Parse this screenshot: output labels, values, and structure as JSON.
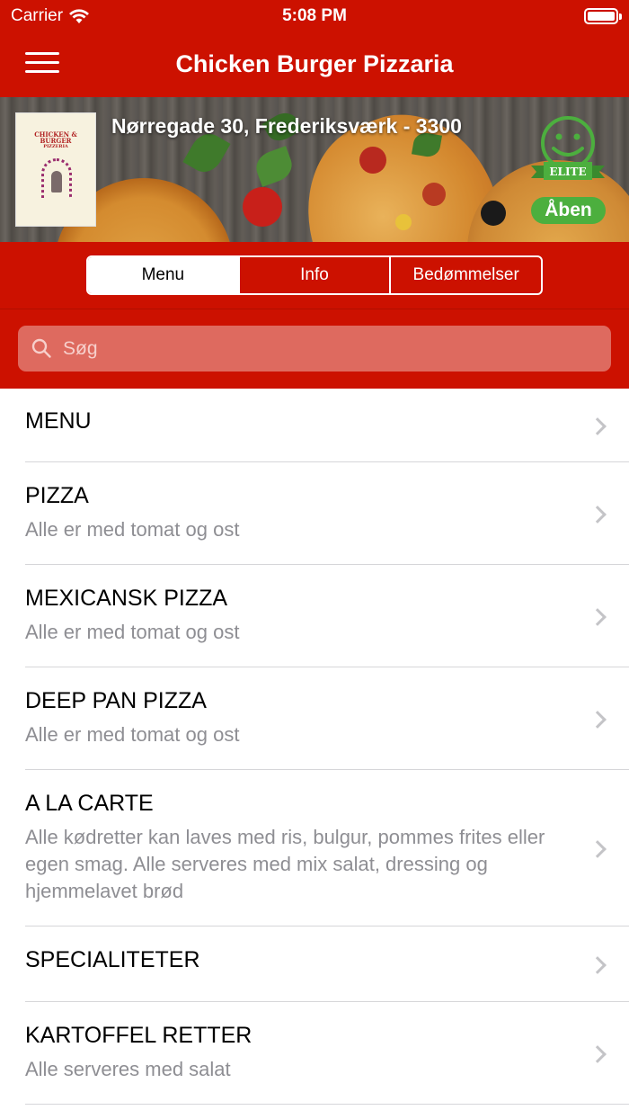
{
  "status_bar": {
    "carrier": "Carrier",
    "time": "5:08 PM"
  },
  "nav": {
    "title": "Chicken Burger Pizzaria",
    "menu_icon": "hamburger-icon"
  },
  "restaurant": {
    "address": "Nørregade 30, Frederiksværk - 3300",
    "logo_text": "CHICKEN & BURGER",
    "logo_subtext": "PIZZERIA",
    "badge_text": "ELITE",
    "status": "Åben",
    "status_color": "#4caf3e"
  },
  "tabs": [
    {
      "label": "Menu",
      "active": true
    },
    {
      "label": "Info",
      "active": false
    },
    {
      "label": "Bedømmelser",
      "active": false
    }
  ],
  "search": {
    "placeholder": "Søg",
    "icon": "search-icon"
  },
  "categories": [
    {
      "title": "MENU",
      "subtitle": ""
    },
    {
      "title": "PIZZA",
      "subtitle": "Alle er med tomat og ost"
    },
    {
      "title": "MEXICANSK PIZZA",
      "subtitle": "Alle er med tomat og ost"
    },
    {
      "title": "DEEP PAN PIZZA",
      "subtitle": "Alle er med tomat og ost"
    },
    {
      "title": "A LA CARTE",
      "subtitle": "Alle kødretter kan laves med ris, bulgur, pommes frites eller egen smag. Alle serveres med mix salat, dressing og hjemmelavet brød"
    },
    {
      "title": "SPECIALITETER",
      "subtitle": ""
    },
    {
      "title": "KARTOFFEL RETTER",
      "subtitle": "Alle serveres med salat"
    }
  ],
  "colors": {
    "brand_red": "#cc1100",
    "search_bg": "#de6a5f",
    "chevron": "#c4c4c7",
    "subtitle": "#8e8e93"
  }
}
